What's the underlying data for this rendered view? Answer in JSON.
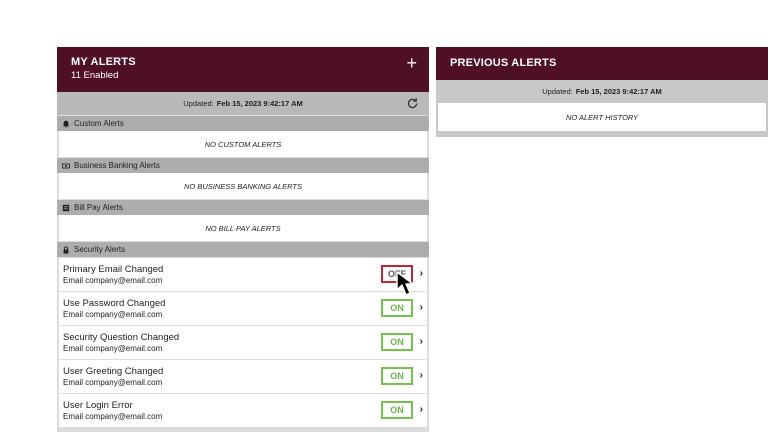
{
  "my_alerts": {
    "title": "MY ALERTS",
    "enabled_count": "11 Enabled",
    "add_icon": "plus-icon",
    "updated_label": "Updated:",
    "updated_value": "Feb 15, 2023 9:42:17 AM",
    "sections": [
      {
        "name": "Custom Alerts",
        "icon": "bell-icon",
        "empty": "NO CUSTOM ALERTS"
      },
      {
        "name": "Business Banking Alerts",
        "icon": "money-icon",
        "empty": "NO BUSINESS BANKING ALERTS"
      },
      {
        "name": "Bill Pay Alerts",
        "icon": "document-icon",
        "empty": "NO BILL PAY ALERTS"
      }
    ],
    "security": {
      "name": "Security Alerts",
      "icon": "lock-icon",
      "items": [
        {
          "title": "Primary Email Changed",
          "email": "Email company@email.com",
          "state": "OFF"
        },
        {
          "title": "Use Password Changed",
          "email": "Email company@email.com",
          "state": "ON"
        },
        {
          "title": "Security Question Changed",
          "email": "Email company@email.com",
          "state": "ON"
        },
        {
          "title": "User Greeting Changed",
          "email": "Email company@email.com",
          "state": "ON"
        },
        {
          "title": "User Login Error",
          "email": "Email company@email.com",
          "state": "ON"
        }
      ]
    }
  },
  "previous_alerts": {
    "title": "PREVIOUS ALERTS",
    "updated_label": "Updated:",
    "updated_value": "Feb 15, 2023 9:42:17 AM",
    "empty": "NO ALERT HISTORY"
  },
  "colors": {
    "header": "#4f0f24",
    "on": "#74c24c",
    "off": "#c2243a"
  }
}
